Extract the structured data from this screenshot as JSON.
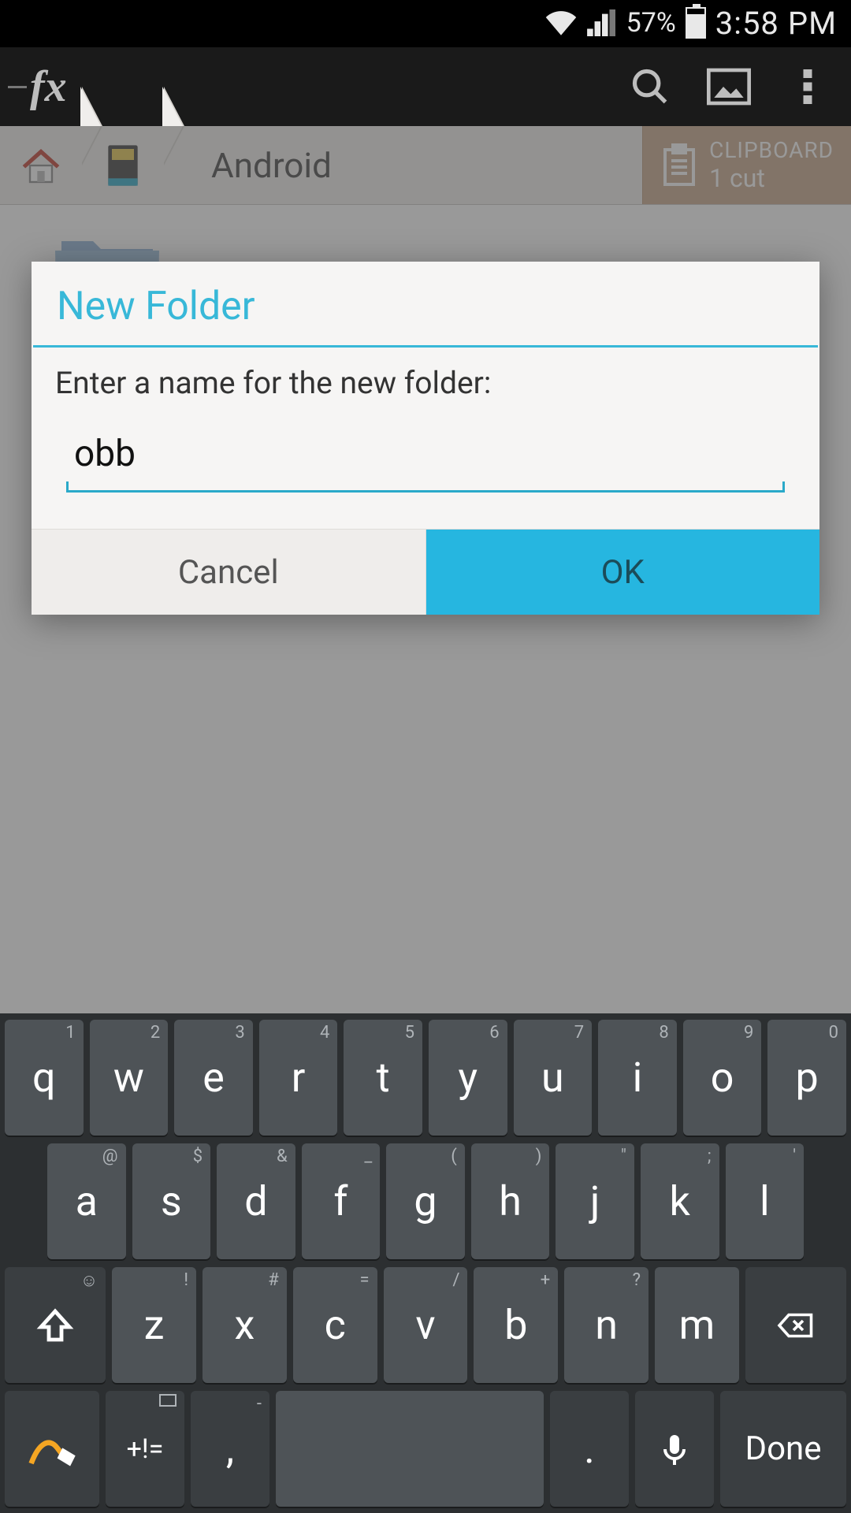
{
  "status": {
    "battery_pct": "57%",
    "time": "3:58 PM"
  },
  "app": {
    "logo": "fx"
  },
  "breadcrumb": {
    "current": "Android"
  },
  "clipboard": {
    "title": "CLIPBOARD",
    "sub": "1 cut"
  },
  "dialog": {
    "title": "New Folder",
    "prompt": "Enter a name for the new folder:",
    "value": "obb",
    "cancel": "Cancel",
    "ok": "OK"
  },
  "keyboard": {
    "row1": [
      {
        "main": "q",
        "sec": "1"
      },
      {
        "main": "w",
        "sec": "2"
      },
      {
        "main": "e",
        "sec": "3"
      },
      {
        "main": "r",
        "sec": "4"
      },
      {
        "main": "t",
        "sec": "5"
      },
      {
        "main": "y",
        "sec": "6"
      },
      {
        "main": "u",
        "sec": "7"
      },
      {
        "main": "i",
        "sec": "8"
      },
      {
        "main": "o",
        "sec": "9"
      },
      {
        "main": "p",
        "sec": "0"
      }
    ],
    "row2": [
      {
        "main": "a",
        "sec": "@"
      },
      {
        "main": "s",
        "sec": "$"
      },
      {
        "main": "d",
        "sec": "&"
      },
      {
        "main": "f",
        "sec": "_"
      },
      {
        "main": "g",
        "sec": "("
      },
      {
        "main": "h",
        "sec": ")"
      },
      {
        "main": "j",
        "sec": "\""
      },
      {
        "main": "k",
        "sec": ";"
      },
      {
        "main": "l",
        "sec": "'"
      }
    ],
    "row3": [
      {
        "main": "z",
        "sec": "!"
      },
      {
        "main": "x",
        "sec": "#"
      },
      {
        "main": "c",
        "sec": "="
      },
      {
        "main": "v",
        "sec": "/"
      },
      {
        "main": "b",
        "sec": "+"
      },
      {
        "main": "n",
        "sec": "?"
      },
      {
        "main": "m",
        "sec": ""
      }
    ],
    "sym": "+!=",
    "comma": ",",
    "period": ".",
    "done": "Done",
    "dash": "-"
  }
}
